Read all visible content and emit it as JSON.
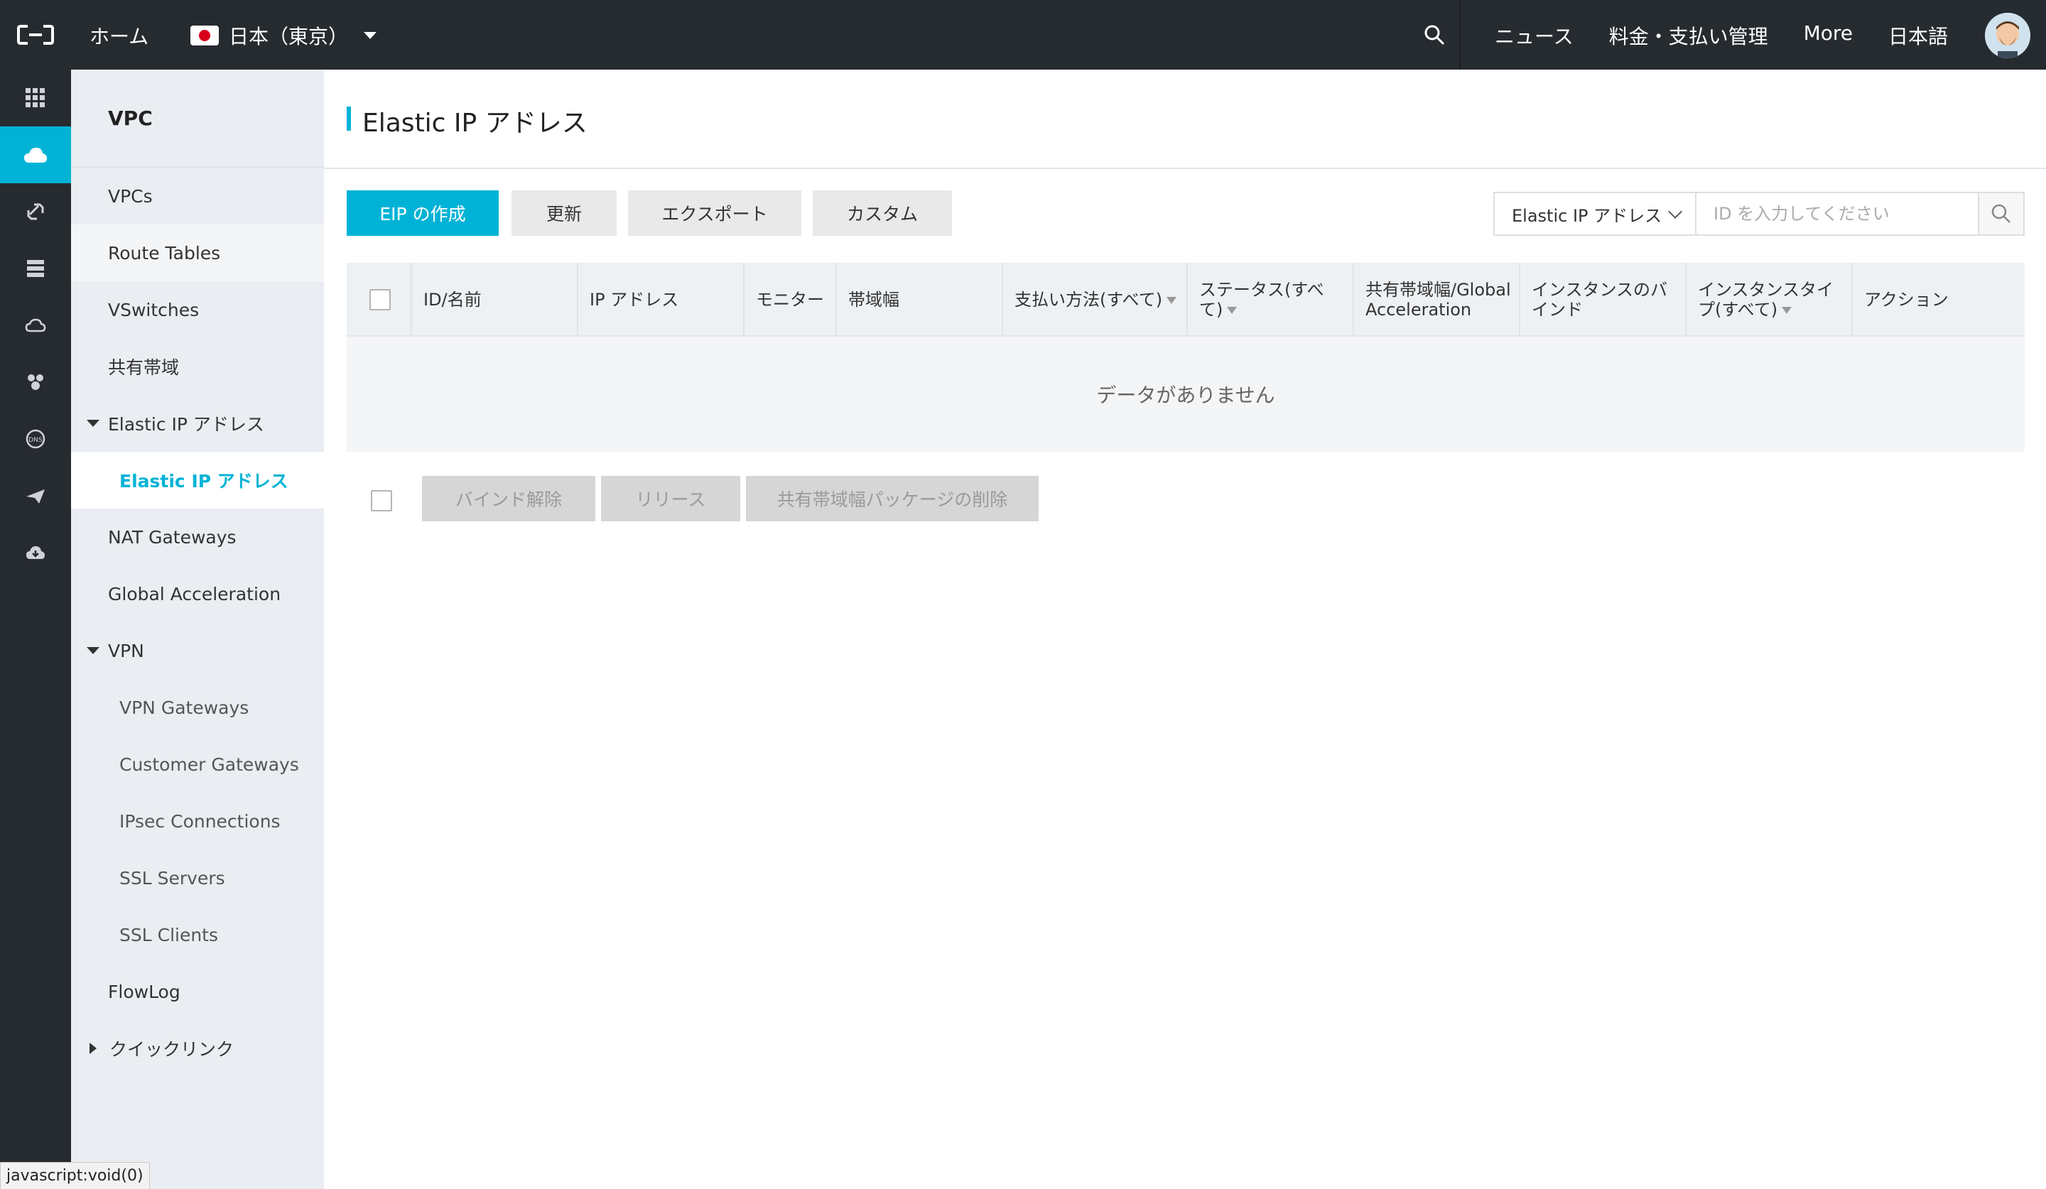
{
  "topbar": {
    "home": "ホーム",
    "region": "日本（東京）",
    "links": [
      "ニュース",
      "料金・支払い管理",
      "More",
      "日本語"
    ]
  },
  "rail": {
    "icons": [
      "grid-icon",
      "cloud-icon",
      "link-icon",
      "server-icon",
      "cloud-outline-icon",
      "network-icon",
      "dns-icon",
      "plane-icon",
      "cloud-download-icon"
    ],
    "active_index": 1
  },
  "sidebar": {
    "title": "VPC",
    "items": {
      "vpcs": "VPCs",
      "route_tables": "Route Tables",
      "vswitches": "VSwitches",
      "shared_bandwidth": "共有帯域",
      "eip_group": "Elastic IP アドレス",
      "eip_sub": "Elastic IP アドレス",
      "nat": "NAT Gateways",
      "global_accel": "Global Acceleration",
      "vpn_group": "VPN",
      "vpn_gateways": "VPN Gateways",
      "customer_gateways": "Customer Gateways",
      "ipsec": "IPsec Connections",
      "ssl_servers": "SSL Servers",
      "ssl_clients": "SSL Clients",
      "flowlog": "FlowLog",
      "quicklinks": "クイックリンク"
    }
  },
  "main": {
    "title": "Elastic IP アドレス",
    "buttons": {
      "create": "EIP の作成",
      "refresh": "更新",
      "export": "エクスポート",
      "custom": "カスタム"
    },
    "filter": {
      "selected": "Elastic IP アドレス",
      "placeholder": "ID を入力してください"
    },
    "table": {
      "columns": {
        "id": "ID/名前",
        "ip": "IP アドレス",
        "monitor": "モニター",
        "bandwidth": "帯域幅",
        "payment": "支払い方法(すべて)",
        "status": "ステータス(すべて)",
        "shared": "共有帯域幅/Global Acceleration",
        "instance_bind": "インスタンスのバインド",
        "instance_type": "インスタンスタイプ(すべて)",
        "action": "アクション"
      },
      "empty": "データがありません"
    },
    "bulk": {
      "unbind": "バインド解除",
      "release": "リリース",
      "delete_pkg": "共有帯域幅パッケージの削除"
    }
  },
  "statusbar": "javascript:void(0)",
  "colors": {
    "topbar": "#262b30",
    "accent": "#00b3d6",
    "sidebar": "#eaedf1"
  }
}
